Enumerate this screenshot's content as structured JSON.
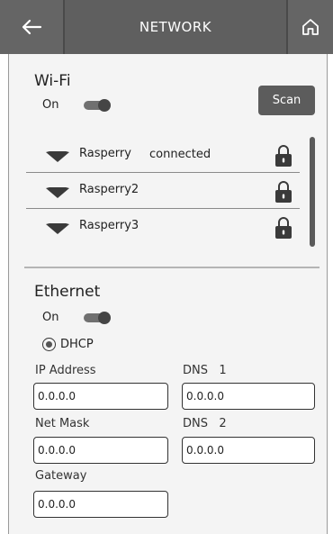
{
  "header": {
    "title": "NETWORK",
    "back_icon": "arrow-left-icon",
    "home_icon": "home-icon"
  },
  "wifi": {
    "title": "Wi-Fi",
    "toggle_label": "On",
    "toggle_on": true,
    "scan_label": "Scan",
    "networks": [
      {
        "name": "Rasperry",
        "status": "connected",
        "locked": true
      },
      {
        "name": "Rasperry2",
        "status": "",
        "locked": true
      },
      {
        "name": "Rasperry3",
        "status": "",
        "locked": true
      }
    ]
  },
  "ethernet": {
    "title": "Ethernet",
    "toggle_label": "On",
    "toggle_on": true,
    "dhcp_label": "DHCP",
    "dhcp_selected": true,
    "ip_address": {
      "label": "IP Address",
      "value": "0.0.0.0"
    },
    "dns1": {
      "label": "DNS   1",
      "value": "0.0.0.0"
    },
    "net_mask": {
      "label": "Net Mask",
      "value": "0.0.0.0"
    },
    "dns2": {
      "label": "DNS   2",
      "value": "0.0.0.0"
    },
    "gateway": {
      "label": "Gateway",
      "value": "0.0.0.0"
    }
  },
  "colors": {
    "header_bg": "#5f5f5f",
    "panel_bg": "#f4f4f4",
    "accent_dark": "#5c5c5c"
  }
}
